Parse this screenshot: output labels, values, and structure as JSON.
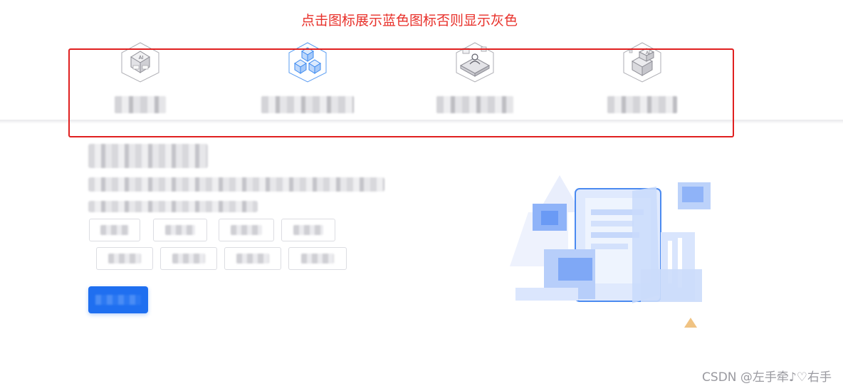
{
  "annotation": "点击图标展示蓝色图标否则显示灰色",
  "tabs": [
    {
      "label": "",
      "icon": "ai-chip-icon",
      "active": false
    },
    {
      "label": "",
      "icon": "cubes-icon",
      "active": true
    },
    {
      "label": "",
      "icon": "person-platform-icon",
      "active": false
    },
    {
      "label": "",
      "icon": "ai-box-icon",
      "active": false
    }
  ],
  "content": {
    "title": "",
    "description_line1": "",
    "description_line2": "",
    "tags": [
      "",
      "",
      "",
      "",
      "",
      "",
      "",
      ""
    ],
    "cta_label": ""
  },
  "watermark": "CSDN @左手牵♪♡右手",
  "colors": {
    "annotation": "#e8302a",
    "highlight_border": "#e02020",
    "active_icon": "#3c8af0",
    "inactive_icon": "#9a9aa0",
    "cta": "#1f6ff0"
  }
}
